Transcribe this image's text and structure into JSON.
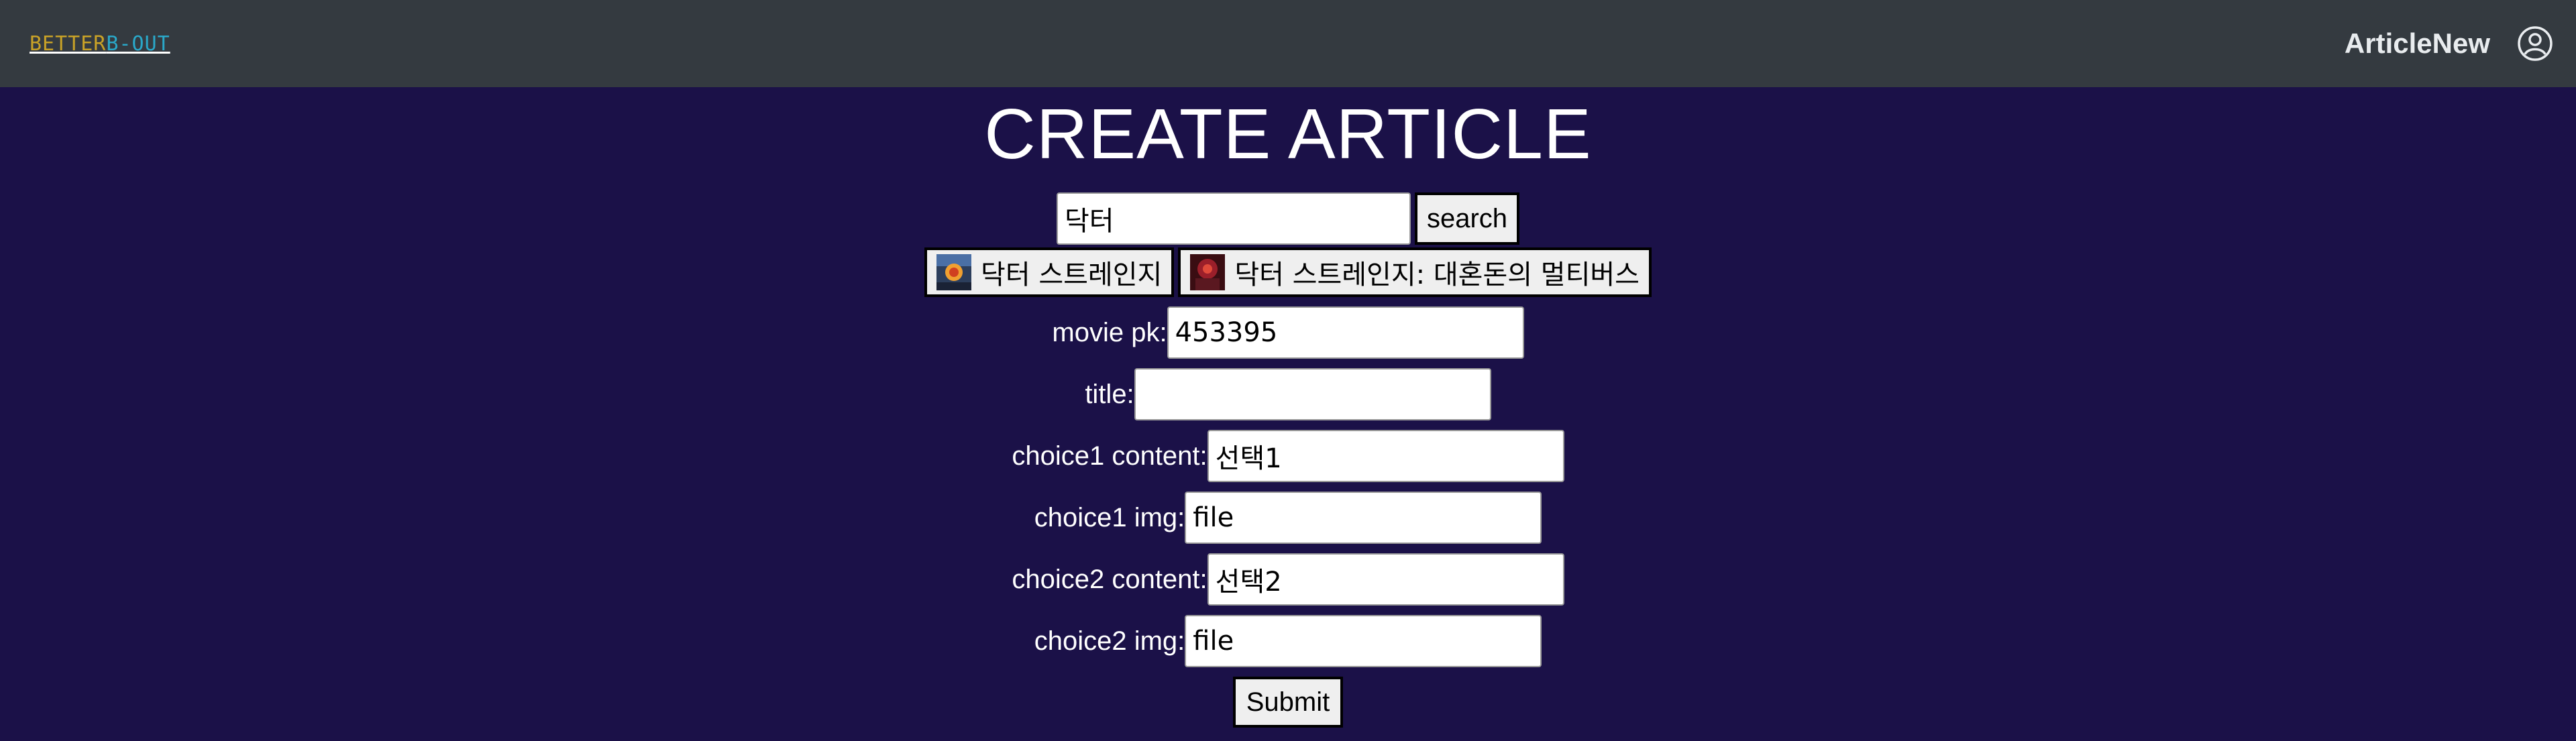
{
  "navbar": {
    "logo_part1": "BETTER",
    "logo_part2": "B-OUT",
    "link_label": "ArticleNew",
    "user_icon": "user-circle-icon"
  },
  "page": {
    "title": "CREATE ARTICLE"
  },
  "search": {
    "value": "닥터",
    "button_label": "search"
  },
  "results": [
    {
      "label": "닥터 스트레인지",
      "thumb_icon": "movie-poster-thumbnail"
    },
    {
      "label": "닥터 스트레인지: 대혼돈의 멀티버스",
      "thumb_icon": "movie-poster-thumbnail"
    }
  ],
  "form": {
    "movie_pk": {
      "label": "movie pk:",
      "value": "453395"
    },
    "title": {
      "label": "title:",
      "value": ""
    },
    "choice1_content": {
      "label": "choice1 content:",
      "value": "선택1"
    },
    "choice1_img": {
      "label": "choice1 img:",
      "value": "file"
    },
    "choice2_content": {
      "label": "choice2 content:",
      "value": "선택2"
    },
    "choice2_img": {
      "label": "choice2 img:",
      "value": "file"
    },
    "submit_label": "Submit"
  },
  "colors": {
    "background": "#1b1148",
    "navbar": "#343a40",
    "logo_gold": "#c9a227",
    "logo_teal": "#2aa8c9"
  }
}
